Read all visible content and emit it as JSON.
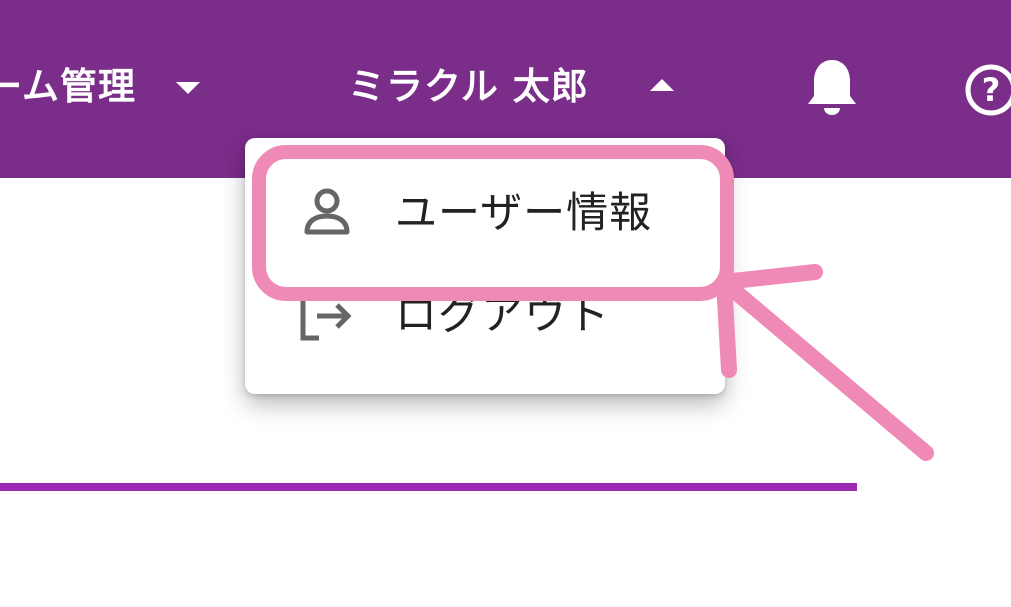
{
  "header": {
    "system_menu_label": "ーム管理",
    "user_menu_label": "ミラクル 太郎"
  },
  "user_menu": {
    "items": [
      {
        "label": "ユーザー情報",
        "icon": "person-icon"
      },
      {
        "label": "ログアウト",
        "icon": "logout-icon"
      }
    ]
  },
  "colors": {
    "header_background": "#7b2d8a",
    "divider_line": "#9c27b0",
    "annotation": "#ee8ab5"
  }
}
